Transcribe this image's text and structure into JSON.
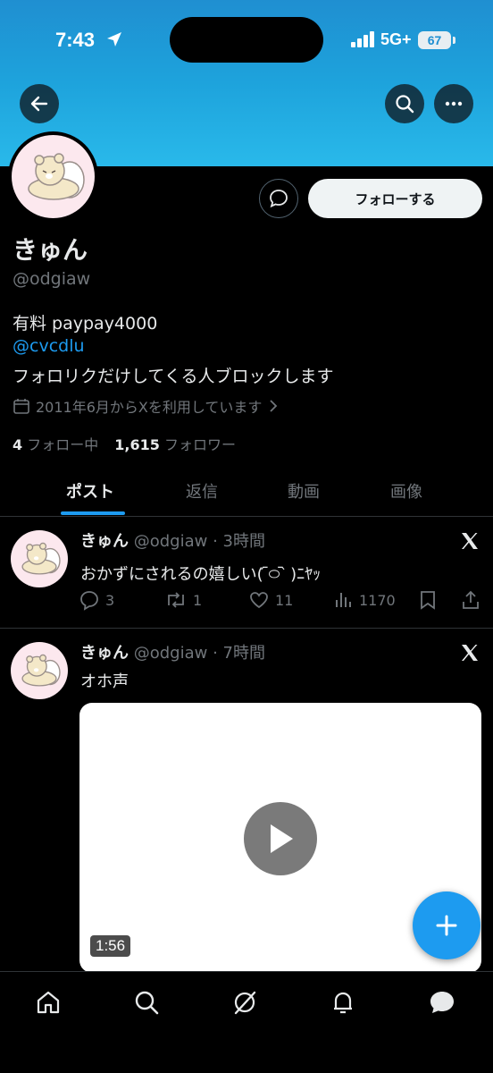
{
  "status": {
    "time": "7:43",
    "network": "5G+",
    "battery": "67"
  },
  "profile": {
    "name": "きゅん",
    "handle": "@odgiaw",
    "bio_line1": "有料 paypay4000",
    "bio_link": "@cvcdlu",
    "bio_line3": "フォロリクだけしてくる人ブロックします",
    "joined": "2011年6月からXを利用しています",
    "following_count": "4",
    "following_label": "フォロー中",
    "followers_count": "1,615",
    "followers_label": "フォロワー",
    "follow_button": "フォローする"
  },
  "tabs": [
    {
      "label": "ポスト",
      "active": true
    },
    {
      "label": "返信",
      "active": false
    },
    {
      "label": "動画",
      "active": false
    },
    {
      "label": "画像",
      "active": false
    }
  ],
  "posts": [
    {
      "name": "きゅん",
      "handle": "@odgiaw",
      "time": "· 3時間",
      "text": "おかずにされるの嬉しい( ᷇࿀ ᷆ )ﾆﾔｯ",
      "replies": "3",
      "reposts": "1",
      "likes": "11",
      "views": "1170"
    },
    {
      "name": "きゅん",
      "handle": "@odgiaw",
      "time": "· 7時間",
      "text": "オホ声",
      "video_duration": "1:56"
    }
  ],
  "nav": [
    "home-icon",
    "search-icon",
    "grok-icon",
    "notifications-icon",
    "messages-icon"
  ],
  "colors": {
    "accent": "#1d9bf0",
    "banner": "#1ea3dc",
    "background": "#000000"
  }
}
